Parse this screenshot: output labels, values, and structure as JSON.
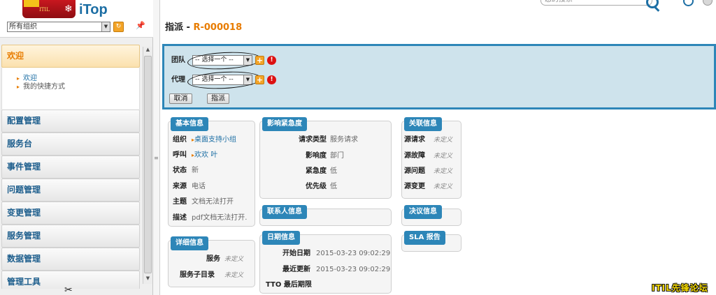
{
  "org": {
    "selected": "所有组织"
  },
  "header": {
    "search_placeholder": "您的搜索"
  },
  "menu": {
    "welcome": {
      "label": "欢迎",
      "items": [
        "欢迎",
        "我的快捷方式"
      ]
    },
    "sections": [
      "配置管理",
      "服务台",
      "事件管理",
      "问题管理",
      "变更管理",
      "服务管理",
      "数据管理",
      "管理工具"
    ]
  },
  "page": {
    "title_prefix": "指派 - ",
    "ref": "R-000018"
  },
  "dispatch": {
    "team_label": "团队",
    "agent_label": "代理",
    "select_placeholder": "-- 选择一个 --",
    "cancel": "取消",
    "submit": "指派"
  },
  "basic": {
    "title": "基本信息",
    "rows": [
      {
        "k": "组织",
        "v": "桌面支持小组"
      },
      {
        "k": "呼叫",
        "v": "欢欢 叶"
      },
      {
        "k": "状态",
        "v": "新"
      },
      {
        "k": "来源",
        "v": "电话"
      },
      {
        "k": "主题",
        "v": "文档无法打开"
      },
      {
        "k": "描述",
        "v": "pdf文档无法打开."
      }
    ]
  },
  "detail": {
    "title": "详细信息",
    "rows": [
      {
        "k": "服务",
        "v": "未定义"
      },
      {
        "k": "服务子目录",
        "v": "未定义"
      }
    ]
  },
  "impact": {
    "title": "影响紧急度",
    "rows": [
      {
        "k": "请求类型",
        "v": "服务请求"
      },
      {
        "k": "影响度",
        "v": "部门"
      },
      {
        "k": "紧急度",
        "v": "低"
      },
      {
        "k": "优先级",
        "v": "低"
      }
    ]
  },
  "contacts": {
    "title": "联系人信息"
  },
  "dates": {
    "title": "日期信息",
    "rows": [
      {
        "k": "开始日期",
        "v": "2015-03-23 09:02:29"
      },
      {
        "k": "最近更新",
        "v": "2015-03-23 09:02:29"
      },
      {
        "k": "TTO 最后期限",
        "v": ""
      }
    ]
  },
  "related": {
    "title": "关联信息",
    "rows": [
      {
        "k": "源请求",
        "v": "未定义"
      },
      {
        "k": "源故障",
        "v": "未定义"
      },
      {
        "k": "源问题",
        "v": "未定义"
      },
      {
        "k": "源变更",
        "v": "未定义"
      }
    ]
  },
  "resolution": {
    "title": "决议信息"
  },
  "sla": {
    "title": "SLA 报告"
  },
  "watermark": "ITIL先锋论坛"
}
